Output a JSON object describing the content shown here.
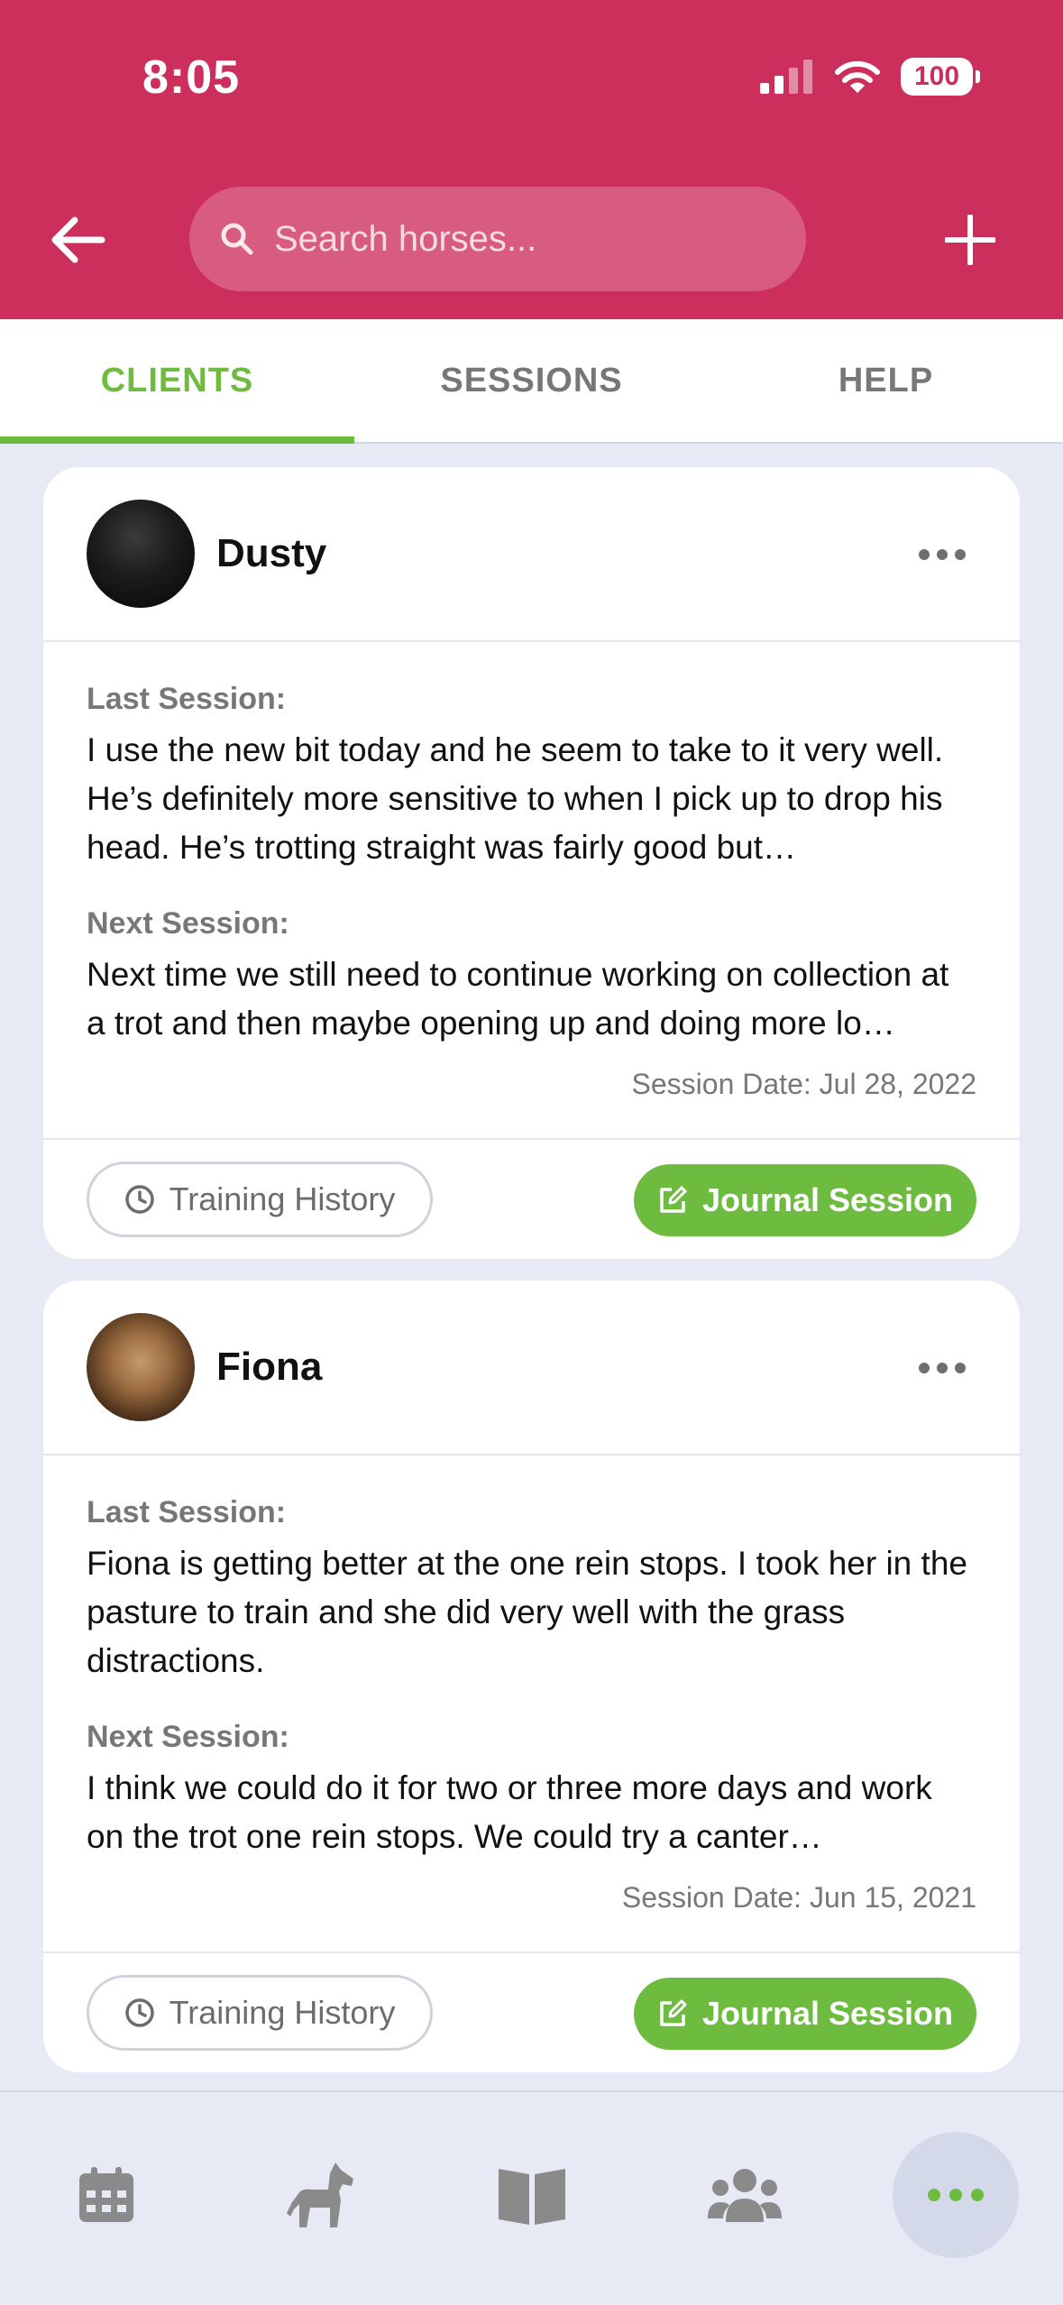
{
  "status_bar": {
    "time": "8:05",
    "battery": "100"
  },
  "header": {
    "search_placeholder": "Search horses..."
  },
  "tabs": [
    {
      "label": "CLIENTS",
      "active": true
    },
    {
      "label": "SESSIONS",
      "active": false
    },
    {
      "label": "HELP",
      "active": false
    }
  ],
  "cards": [
    {
      "name": "Dusty",
      "last_label": "Last Session:",
      "last_text": "I use the new bit today and he seem to take to it very well. He’s definitely more sensitive to when I pick up to drop his head. He’s trotting straight was fairly good but…",
      "next_label": "Next Session:",
      "next_text": "Next time we still need to continue working on collection at a trot and then maybe opening up and doing more lo…",
      "session_date": "Session Date: Jul 28, 2022",
      "history_label": "Training History",
      "journal_label": "Journal Session"
    },
    {
      "name": "Fiona",
      "last_label": "Last Session:",
      "last_text": "Fiona is getting better at the one rein stops.  I took her in the pasture to train and she did very well with the grass distractions.",
      "next_label": "Next Session:",
      "next_text": "I think we could do it for two or three more days and work on the trot one  rein stops.  We could try a canter…",
      "session_date": "Session Date: Jun 15, 2021",
      "history_label": "Training History",
      "journal_label": "Journal Session"
    }
  ],
  "colors": {
    "brand": "#cc2f5c",
    "accent": "#6dbb3f",
    "background": "#e7eaf4"
  },
  "bottom_nav": [
    "calendar-icon",
    "horse-icon",
    "book-icon",
    "people-icon",
    "more-icon"
  ]
}
